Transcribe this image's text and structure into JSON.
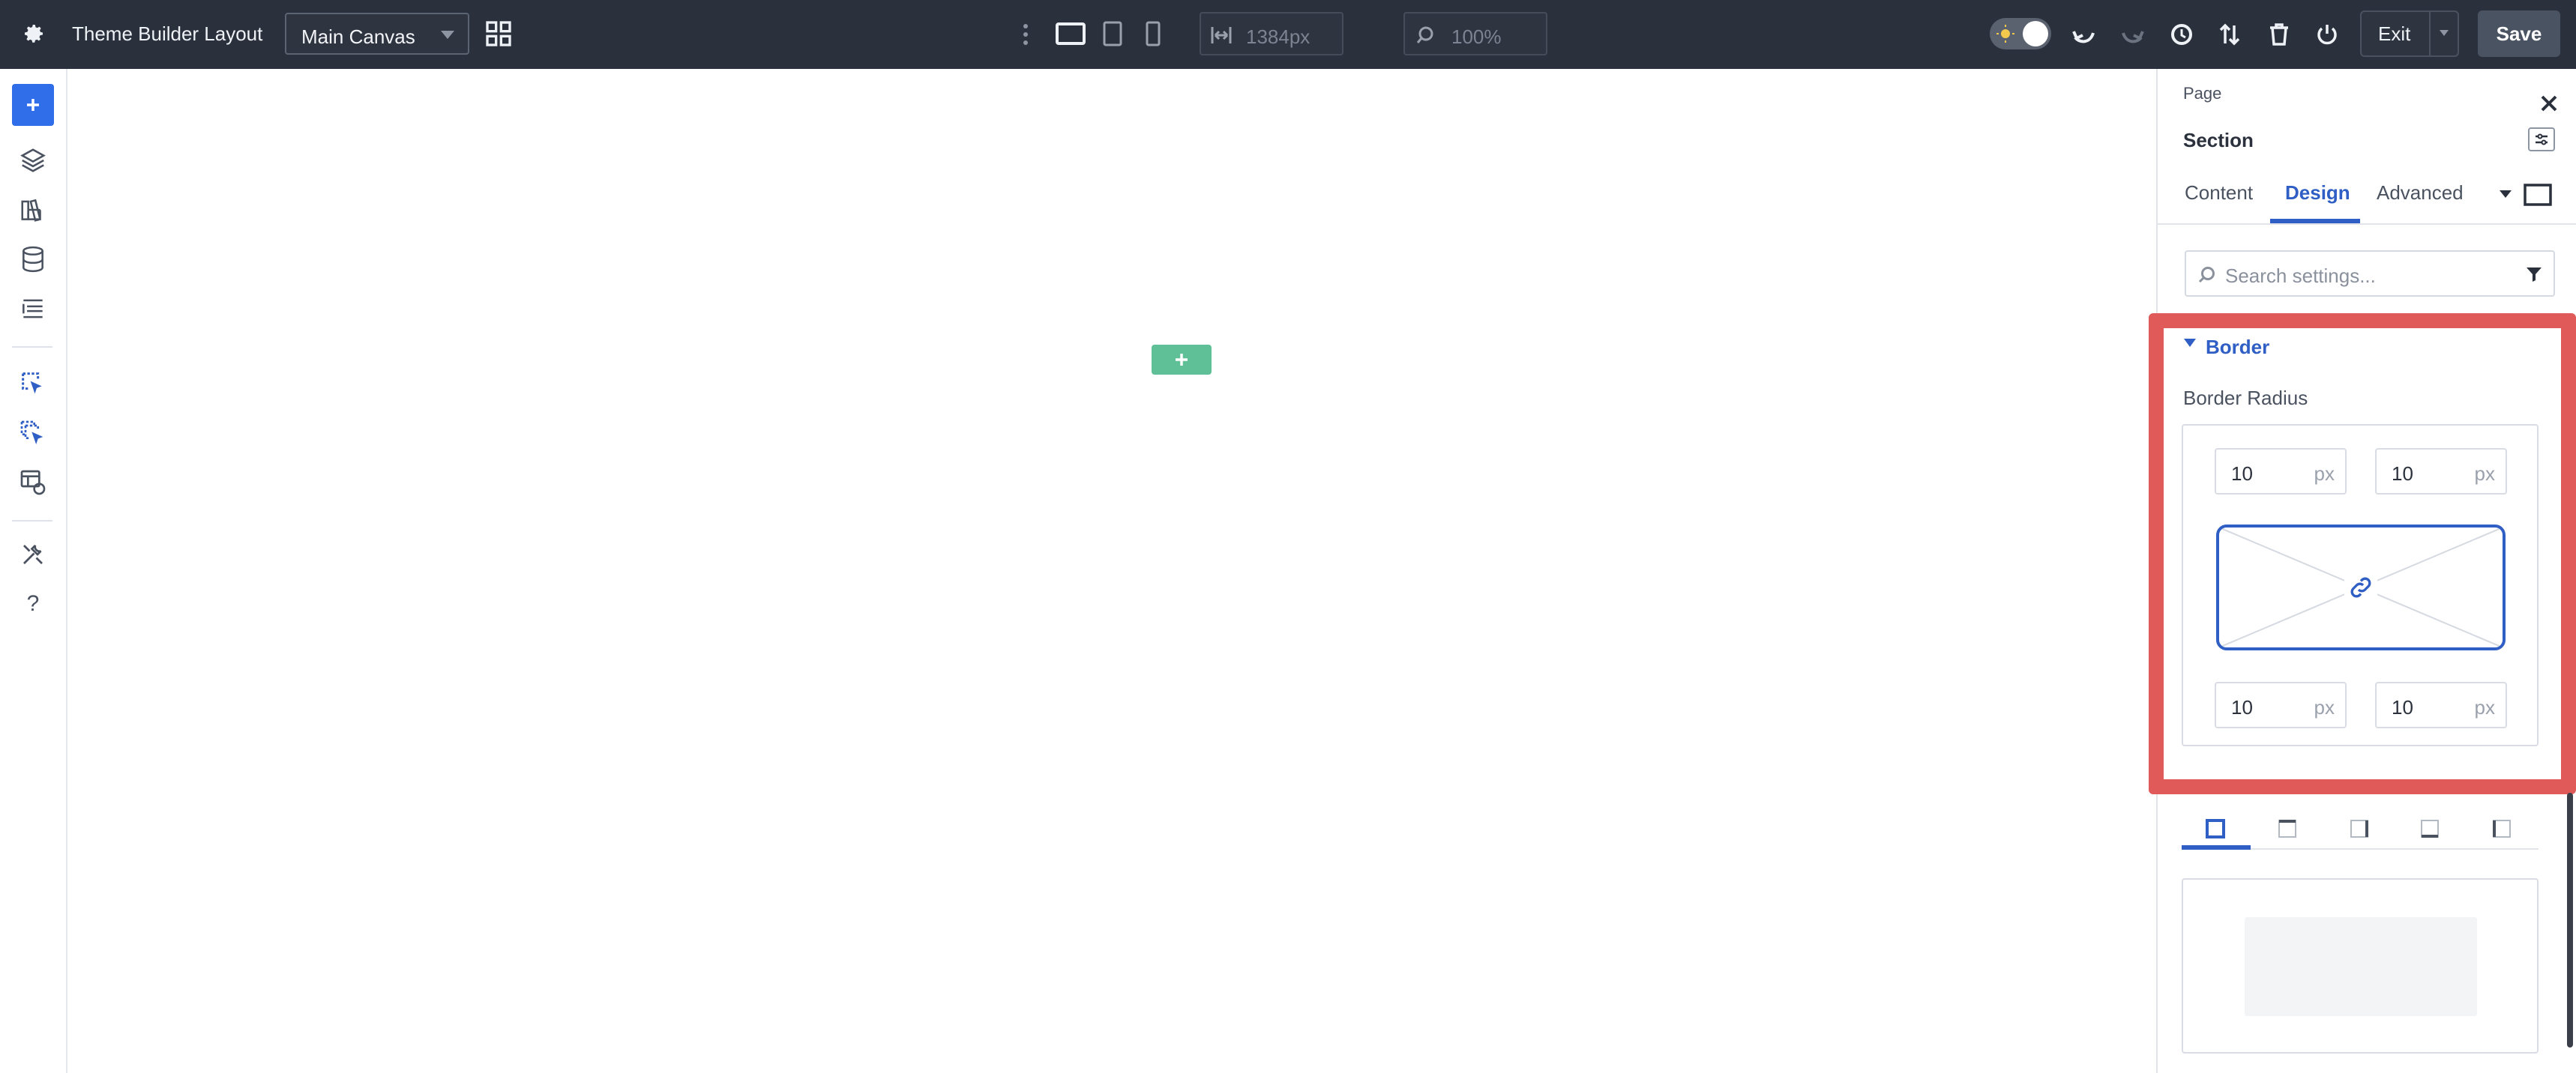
{
  "topbar": {
    "app_title": "Theme Builder Layout",
    "canvas_select": "Main Canvas",
    "width_value": "1384px",
    "zoom_value": "100%",
    "exit_label": "Exit",
    "save_label": "Save"
  },
  "panel": {
    "breadcrumb": "Page",
    "element_title": "Section",
    "tabs": [
      {
        "label": "Content"
      },
      {
        "label": "Design"
      },
      {
        "label": "Advanced"
      }
    ],
    "search_placeholder": "Search settings...",
    "border_section": {
      "title": "Border",
      "radius_label": "Border Radius",
      "top_left": "10",
      "top_right": "10",
      "bottom_left": "10",
      "bottom_right": "10",
      "unit": "px"
    }
  },
  "colors": {
    "topbar_bg": "#2b313c",
    "accent_blue": "#2f5ec4",
    "add_green": "#5fbf96",
    "highlight_red": "#e05a5a"
  }
}
